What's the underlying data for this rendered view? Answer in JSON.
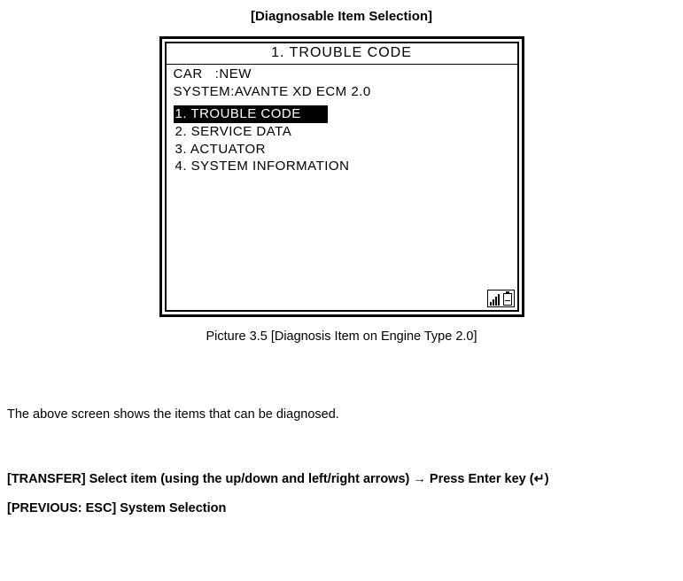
{
  "title": "[Diagnosable Item Selection]",
  "screen": {
    "header": "1. TROUBLE CODE",
    "info": {
      "car_label": "CAR",
      "car_value": ":NEW",
      "system_label": "SYSTEM",
      "system_value": ":AVANTE XD ECM 2.0"
    },
    "menu": [
      {
        "label": "1. TROUBLE CODE",
        "selected": true
      },
      {
        "label": "2. SERVICE DATA",
        "selected": false
      },
      {
        "label": "3. ACTUATOR",
        "selected": false
      },
      {
        "label": "4. SYSTEM INFORMATION",
        "selected": false
      }
    ]
  },
  "caption": "Picture 3.5 [Diagnosis Item on Engine Type 2.0]",
  "paragraph": "The above screen shows the items that can be diagnosed.",
  "transfer_line": "[TRANSFER] Select item (using the up/down and left/right arrows) → Press Enter key (↵)",
  "previous_line": "[PREVIOUS: ESC] System Selection"
}
